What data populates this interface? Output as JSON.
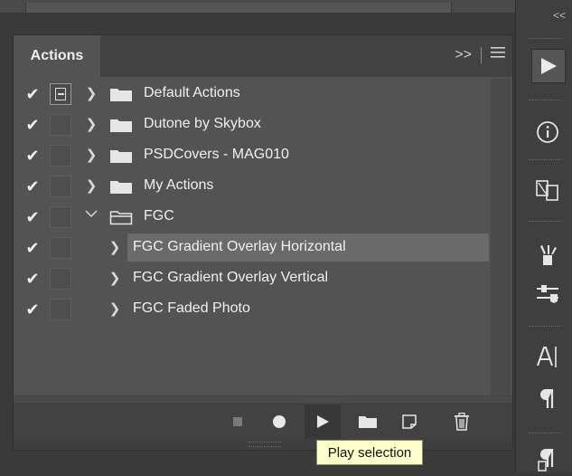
{
  "panel": {
    "tab_label": "Actions",
    "menu_label": ">>",
    "menu_icon": "hamburger-icon"
  },
  "rows": [
    {
      "label": "Default Actions",
      "checked": true,
      "dialog_toggle": true,
      "expanded": false,
      "type": "set"
    },
    {
      "label": "Dutone by Skybox",
      "checked": true,
      "dialog_toggle": false,
      "expanded": false,
      "type": "set"
    },
    {
      "label": "PSDCovers - MAG010",
      "checked": true,
      "dialog_toggle": false,
      "expanded": false,
      "type": "set"
    },
    {
      "label": "My Actions",
      "checked": true,
      "dialog_toggle": false,
      "expanded": false,
      "type": "set"
    },
    {
      "label": "FGC",
      "checked": true,
      "dialog_toggle": false,
      "expanded": true,
      "type": "set"
    },
    {
      "label": "FGC Gradient Overlay Horizontal",
      "checked": true,
      "dialog_toggle": false,
      "expanded": false,
      "type": "action",
      "selected": true
    },
    {
      "label": "FGC Gradient Overlay Vertical",
      "checked": true,
      "dialog_toggle": false,
      "expanded": false,
      "type": "action"
    },
    {
      "label": "FGC Faded Photo",
      "checked": true,
      "dialog_toggle": false,
      "expanded": false,
      "type": "action"
    }
  ],
  "toolbar": {
    "buttons": [
      "stop-icon",
      "record-icon",
      "play-icon",
      "new-set-folder-icon",
      "new-action-icon",
      "trash-icon"
    ]
  },
  "tooltip": {
    "text": "Play selection"
  },
  "dock": {
    "collapse_label": "<<",
    "icons": [
      "actions-play-icon",
      "info-icon",
      "artboard-icon",
      "brushes-icon",
      "adjustments-icon",
      "character-icon",
      "paragraph-icon",
      "paragraph-styles-icon"
    ]
  }
}
